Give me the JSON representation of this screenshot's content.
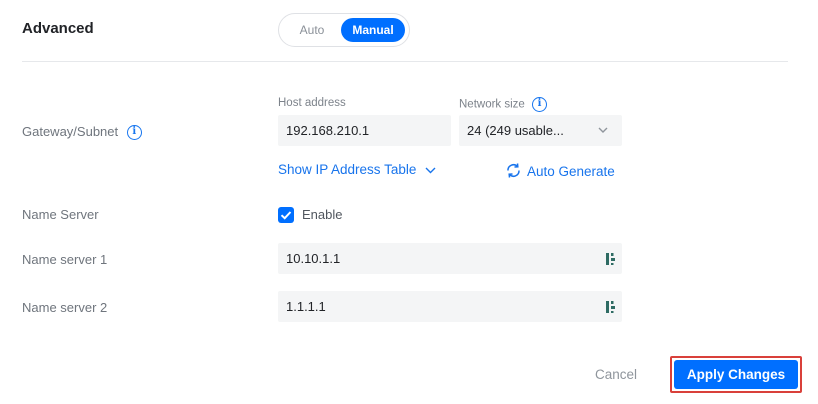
{
  "header": {
    "title": "Advanced",
    "mode_options": [
      "Auto",
      "Manual"
    ],
    "selected_mode": "Manual"
  },
  "gateway_subnet": {
    "label": "Gateway/Subnet",
    "host_address_label": "Host address",
    "host_address_value": "192.168.210.1",
    "network_size_label": "Network size",
    "network_size_value": "24 (249 usable...",
    "show_table_link": "Show IP Address Table",
    "auto_generate_link": "Auto Generate"
  },
  "name_server": {
    "label": "Name Server",
    "enable_label": "Enable",
    "enabled": true
  },
  "name_server_1": {
    "label": "Name server 1",
    "value": "10.10.1.1"
  },
  "name_server_2": {
    "label": "Name server 2",
    "value": "1.1.1.1"
  },
  "footer": {
    "cancel_label": "Cancel",
    "apply_label": "Apply Changes"
  },
  "colors": {
    "accent": "#006fff",
    "highlight_outline": "#d9403a"
  }
}
